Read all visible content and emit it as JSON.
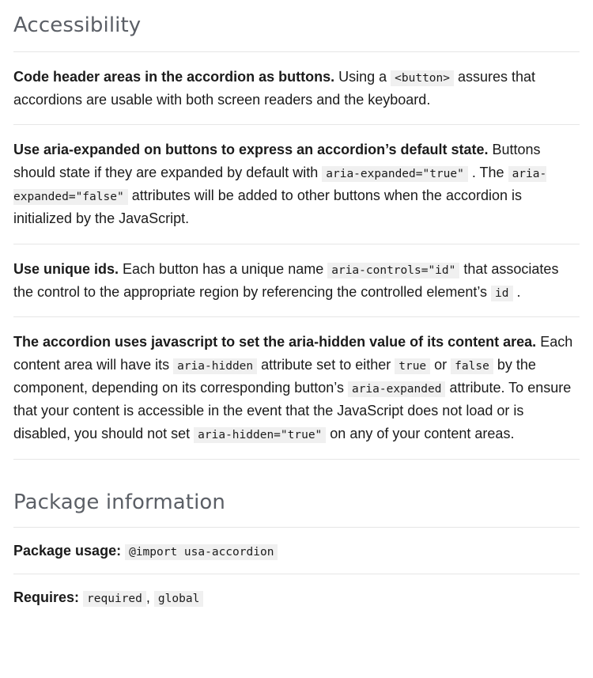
{
  "sections": {
    "accessibility": {
      "heading": "Accessibility",
      "items": [
        {
          "lead": "Code header areas in the accordion as buttons.",
          "parts": [
            {
              "type": "text",
              "value": " Using a "
            },
            {
              "type": "code",
              "value": "<button>"
            },
            {
              "type": "text",
              "value": " assures that accordions are usable with both screen readers and the keyboard."
            }
          ]
        },
        {
          "lead": "Use aria-expanded on buttons to express an accordion’s default state.",
          "parts": [
            {
              "type": "text",
              "value": " Buttons should state if they are expanded by default with "
            },
            {
              "type": "code",
              "value": "aria-expanded=\"true\""
            },
            {
              "type": "text",
              "value": " . The "
            },
            {
              "type": "code",
              "value": "aria-expanded=\"false\""
            },
            {
              "type": "text",
              "value": " attributes will be added to other buttons when the accordion is initialized by the JavaScript."
            }
          ]
        },
        {
          "lead": "Use unique ids.",
          "parts": [
            {
              "type": "text",
              "value": " Each button has a unique name "
            },
            {
              "type": "code",
              "value": "aria-controls=\"id\""
            },
            {
              "type": "text",
              "value": " that associates the control to the appropriate region by referencing the controlled element’s "
            },
            {
              "type": "code",
              "value": "id"
            },
            {
              "type": "text",
              "value": " ."
            }
          ]
        },
        {
          "lead": "The accordion uses javascript to set the aria-hidden value of its content area.",
          "parts": [
            {
              "type": "text",
              "value": " Each content area will have its "
            },
            {
              "type": "code",
              "value": "aria-hidden"
            },
            {
              "type": "text",
              "value": " attribute set to either "
            },
            {
              "type": "code",
              "value": "true"
            },
            {
              "type": "text",
              "value": " or "
            },
            {
              "type": "code",
              "value": "false"
            },
            {
              "type": "text",
              "value": " by the component, depending on its corresponding button’s "
            },
            {
              "type": "code",
              "value": "aria-expanded"
            },
            {
              "type": "text",
              "value": " attribute. To ensure that your content is accessible in the event that the JavaScript does not load or is disabled, you should not set "
            },
            {
              "type": "code",
              "value": "aria-hidden=\"true\""
            },
            {
              "type": "text",
              "value": " on any of your content areas."
            }
          ]
        }
      ]
    },
    "package_information": {
      "heading": "Package information",
      "rows": [
        {
          "label": "Package usage:",
          "codes": [
            "@import usa-accordion"
          ],
          "separator": ""
        },
        {
          "label": "Requires:",
          "codes": [
            "required",
            "global"
          ],
          "separator": ","
        }
      ]
    }
  },
  "colors": {
    "heading": "#5b5f66",
    "body_text": "#1b1b1b",
    "divider": "#e6e6e6",
    "code_background": "#f0f0f0",
    "page_background": "#ffffff"
  }
}
